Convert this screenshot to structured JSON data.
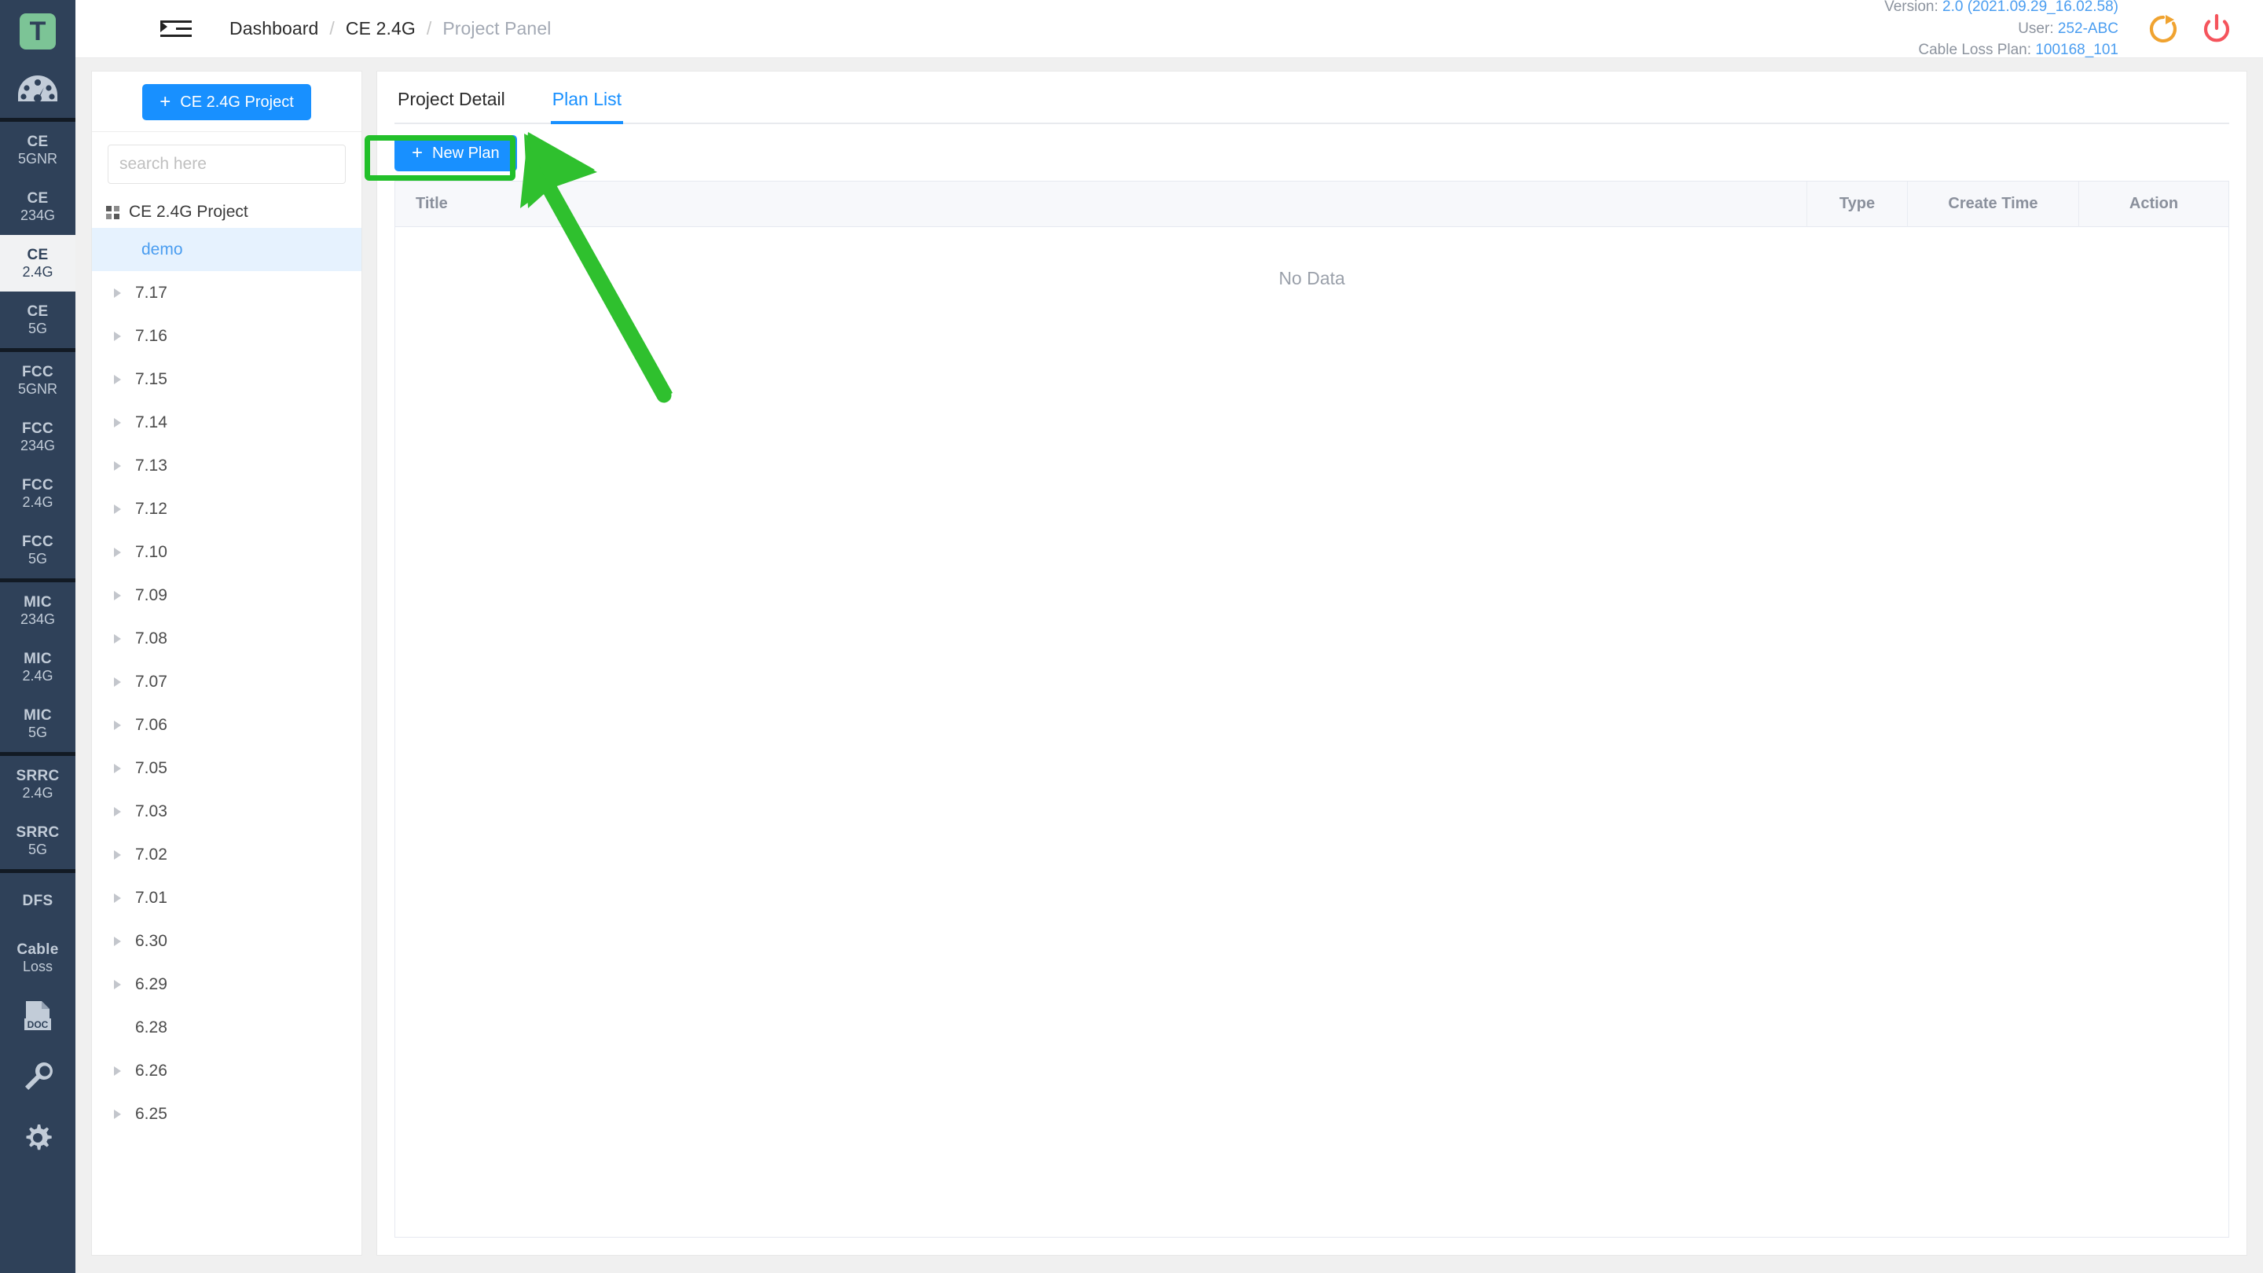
{
  "header": {
    "menu_toggle": "menu-collapse-icon",
    "breadcrumb": [
      {
        "label": "Dashboard",
        "current": false
      },
      {
        "label": "CE 2.4G",
        "current": false
      },
      {
        "label": "Project Panel",
        "current": true
      }
    ],
    "breadcrumb_separator": "/",
    "meta": {
      "version_label": "Version:",
      "version_value": "2.0 (2021.09.29_16.02.58)",
      "user_label": "User:",
      "user_value": "252-ABC",
      "cable_loss_label": "Cable Loss Plan:",
      "cable_loss_value": "100168_101"
    },
    "actions": [
      {
        "name": "refresh-icon",
        "color": "#f0a330"
      },
      {
        "name": "power-icon",
        "color": "#f5545c"
      }
    ]
  },
  "rail": {
    "logo_letter": "T",
    "logo_color": "#7cc496",
    "dashboard_icon": "gauge-icon",
    "groups": [
      {
        "items": [
          {
            "line1": "CE",
            "line2": "5GNR",
            "active": false
          },
          {
            "line1": "CE",
            "line2": "234G",
            "active": false
          },
          {
            "line1": "CE",
            "line2": "2.4G",
            "active": true
          },
          {
            "line1": "CE",
            "line2": "5G",
            "active": false
          }
        ]
      },
      {
        "items": [
          {
            "line1": "FCC",
            "line2": "5GNR",
            "active": false
          },
          {
            "line1": "FCC",
            "line2": "234G",
            "active": false
          },
          {
            "line1": "FCC",
            "line2": "2.4G",
            "active": false
          },
          {
            "line1": "FCC",
            "line2": "5G",
            "active": false
          }
        ]
      },
      {
        "items": [
          {
            "line1": "MIC",
            "line2": "234G",
            "active": false
          },
          {
            "line1": "MIC",
            "line2": "2.4G",
            "active": false
          },
          {
            "line1": "MIC",
            "line2": "5G",
            "active": false
          }
        ]
      },
      {
        "items": [
          {
            "line1": "SRRC",
            "line2": "2.4G",
            "active": false
          },
          {
            "line1": "SRRC",
            "line2": "5G",
            "active": false
          }
        ]
      },
      {
        "items": [
          {
            "line1": "DFS",
            "line2": "",
            "active": false
          },
          {
            "line1": "Cable",
            "line2": "Loss",
            "active": false
          }
        ]
      }
    ],
    "bottom_icons": [
      {
        "name": "doc-icon",
        "label": "DOC"
      },
      {
        "name": "wrench-icon",
        "label": ""
      },
      {
        "name": "gear-icon",
        "label": ""
      }
    ]
  },
  "project_panel": {
    "new_project_button": "CE 2.4G Project",
    "new_project_plus": "+",
    "search_placeholder": "search here",
    "search_value": "",
    "tree_root": "CE 2.4G Project",
    "nodes": [
      {
        "label": "demo",
        "selected": true,
        "expandable": false
      },
      {
        "label": "7.17",
        "selected": false,
        "expandable": true
      },
      {
        "label": "7.16",
        "selected": false,
        "expandable": true
      },
      {
        "label": "7.15",
        "selected": false,
        "expandable": true
      },
      {
        "label": "7.14",
        "selected": false,
        "expandable": true
      },
      {
        "label": "7.13",
        "selected": false,
        "expandable": true
      },
      {
        "label": "7.12",
        "selected": false,
        "expandable": true
      },
      {
        "label": "7.10",
        "selected": false,
        "expandable": true
      },
      {
        "label": "7.09",
        "selected": false,
        "expandable": true
      },
      {
        "label": "7.08",
        "selected": false,
        "expandable": true
      },
      {
        "label": "7.07",
        "selected": false,
        "expandable": true
      },
      {
        "label": "7.06",
        "selected": false,
        "expandable": true
      },
      {
        "label": "7.05",
        "selected": false,
        "expandable": true
      },
      {
        "label": "7.03",
        "selected": false,
        "expandable": true
      },
      {
        "label": "7.02",
        "selected": false,
        "expandable": true
      },
      {
        "label": "7.01",
        "selected": false,
        "expandable": true
      },
      {
        "label": "6.30",
        "selected": false,
        "expandable": true
      },
      {
        "label": "6.29",
        "selected": false,
        "expandable": true
      },
      {
        "label": "6.28",
        "selected": false,
        "expandable": false
      },
      {
        "label": "6.26",
        "selected": false,
        "expandable": true
      },
      {
        "label": "6.25",
        "selected": false,
        "expandable": true
      }
    ]
  },
  "main": {
    "tabs": [
      {
        "label": "Project Detail",
        "active": false
      },
      {
        "label": "Plan List",
        "active": true
      }
    ],
    "new_plan_button": "New Plan",
    "new_plan_plus": "+",
    "table": {
      "columns": [
        "Title",
        "Type",
        "Create Time",
        "Action"
      ],
      "rows": [],
      "empty_text": "No Data"
    }
  },
  "annotation": {
    "highlight_color": "#22c02a",
    "arrow_color": "#2fc02e",
    "target": "new-plan-button"
  }
}
